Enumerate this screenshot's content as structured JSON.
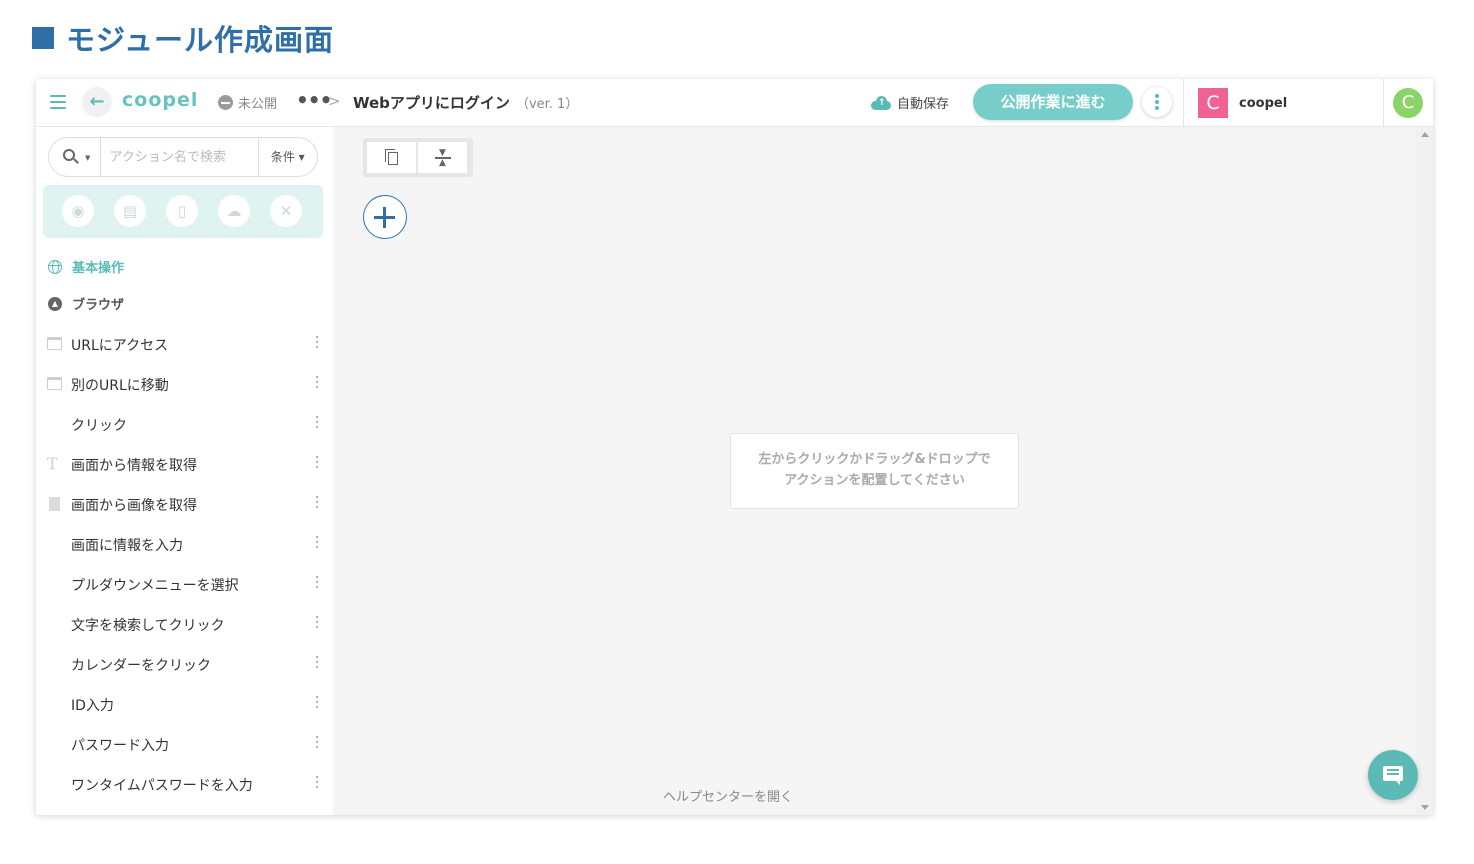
{
  "page_heading": "モジュール作成画面",
  "header": {
    "logo": "coopel",
    "status": "未公開",
    "more": "•••",
    "separator": ">",
    "title": "Webアプリにログイン",
    "version": "（ver. 1）",
    "autosave": "自動保存",
    "publish": "公開作業に進む",
    "org_initial": "C",
    "org_name": "coopel",
    "user_initial": "C",
    "colors": {
      "accent": "#5bbab6",
      "publish": "#76cdc9",
      "org": "#f06293",
      "user": "#8cd36a",
      "heading": "#2f6fa8"
    }
  },
  "sidebar": {
    "search_placeholder": "アクション名で検索",
    "filter_label": "条件 ▾",
    "categories": [
      "globe-icon",
      "excel-icon",
      "file-icon",
      "cloud-icon",
      "tools-icon"
    ],
    "section": "基本操作",
    "group": "ブラウザ",
    "actions": [
      {
        "label": "URLにアクセス",
        "icon": "window-icon"
      },
      {
        "label": "別のURLに移動",
        "icon": "window-icon"
      },
      {
        "label": "クリック",
        "icon": "none"
      },
      {
        "label": "画面から情報を取得",
        "icon": "text-icon"
      },
      {
        "label": "画面から画像を取得",
        "icon": "document-icon"
      },
      {
        "label": "画面に情報を入力",
        "icon": "none"
      },
      {
        "label": "プルダウンメニューを選択",
        "icon": "none"
      },
      {
        "label": "文字を検索してクリック",
        "icon": "none"
      },
      {
        "label": "カレンダーをクリック",
        "icon": "none"
      },
      {
        "label": "ID入力",
        "icon": "none"
      },
      {
        "label": "パスワード入力",
        "icon": "none"
      },
      {
        "label": "ワンタイムパスワードを入力",
        "icon": "none"
      }
    ]
  },
  "canvas": {
    "empty_line1": "左からクリックかドラッグ&ドロップで",
    "empty_line2": "アクションを配置してください",
    "help": "ヘルプセンターを開く"
  }
}
